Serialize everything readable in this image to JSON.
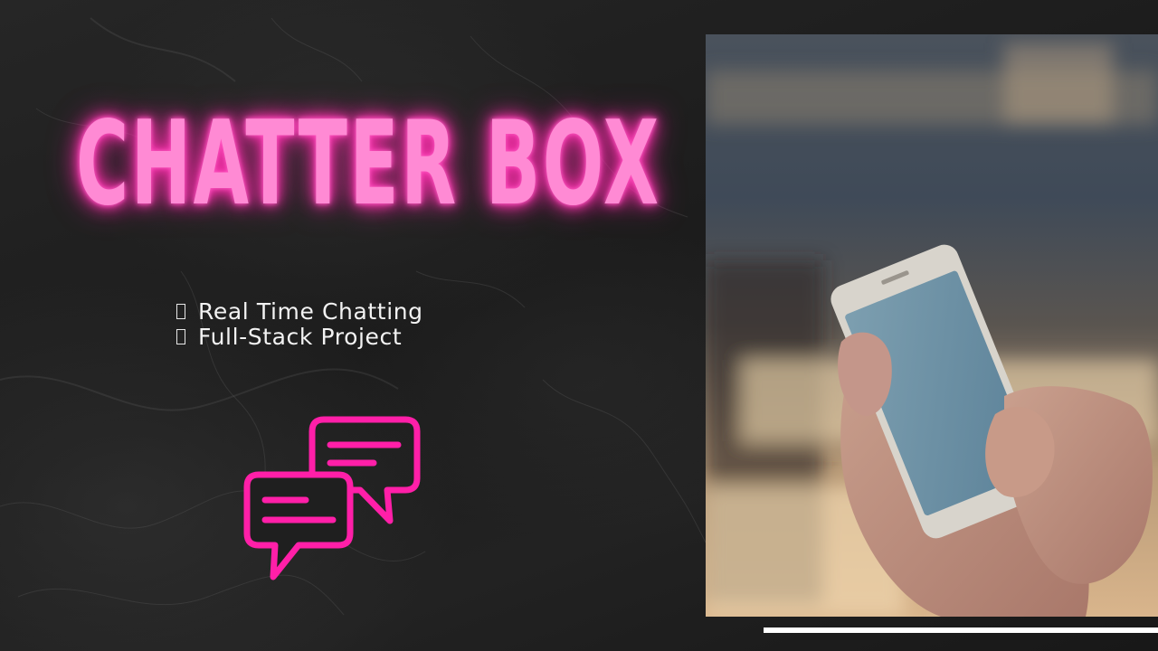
{
  "title": "CHATTER BOX",
  "features": [
    "Real Time Chatting",
    "Full-Stack Project"
  ],
  "icons": {
    "chat": "chat-bubbles-icon",
    "bullet": "checkbox-outline-icon"
  },
  "colors": {
    "background": "#1b1b1b",
    "neon_pink": "#ff8ad4",
    "icon_pink": "#ff1fa8",
    "text": "#f2f2f2",
    "accent_bar": "#ffffff"
  }
}
